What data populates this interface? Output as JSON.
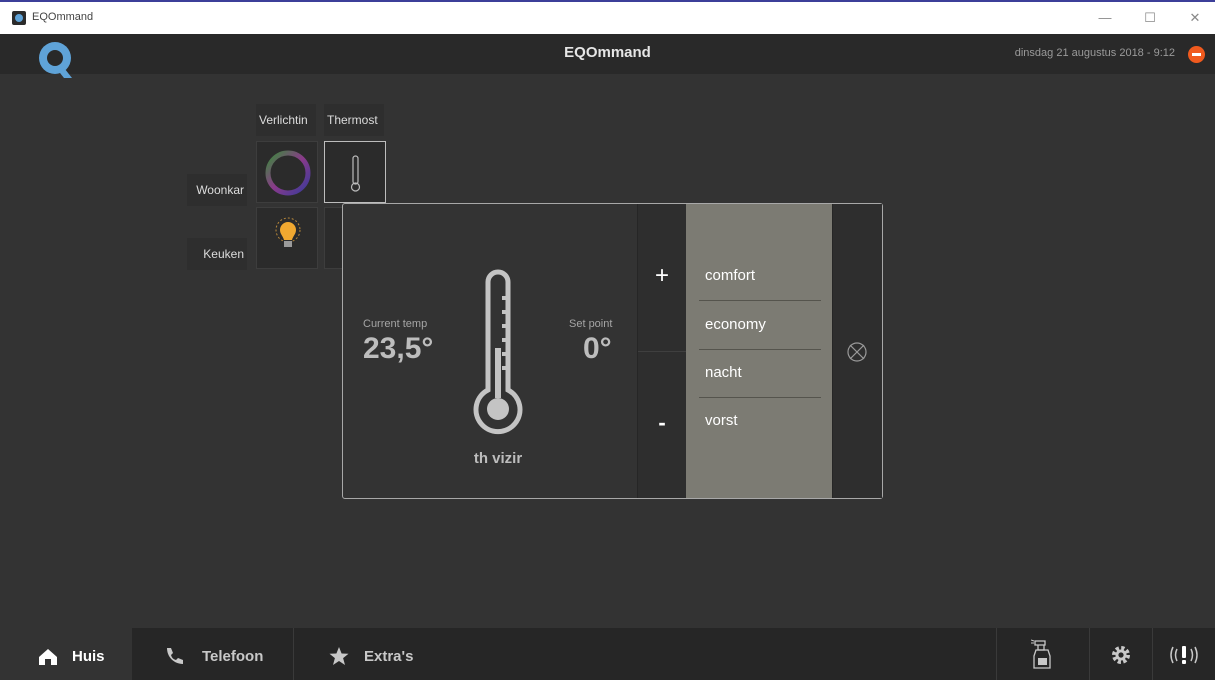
{
  "window": {
    "title": "EQOmmand",
    "controls": [
      "—",
      "☐",
      "✕"
    ]
  },
  "header": {
    "app_title": "EQOmmand",
    "datetime": "dinsdag 21 augustus 2018 - 9:12"
  },
  "grid": {
    "columns": [
      "Verlichtin",
      "Thermost"
    ],
    "rows": [
      "Woonkar",
      "Keuken"
    ]
  },
  "popup": {
    "current_temp_label": "Current temp",
    "current_temp_value": "23,5°",
    "set_point_label": "Set point",
    "set_point_value": "0°",
    "device_name": "th vizir",
    "plus_label": "+",
    "minus_label": "-",
    "modes": [
      "comfort",
      "economy",
      "nacht",
      "vorst"
    ]
  },
  "nav": {
    "tabs": [
      {
        "label": "Huis",
        "icon": "home-icon",
        "active": true
      },
      {
        "label": "Telefoon",
        "icon": "phone-icon",
        "active": false
      },
      {
        "label": "Extra's",
        "icon": "star-icon",
        "active": false
      }
    ],
    "right_icons": [
      "cleaning-spray-icon",
      "gear-icon",
      "alarm-icon"
    ]
  },
  "colors": {
    "background": "#333333",
    "mode_panel": "#7c7b73",
    "accent_stop": "#f05a1e",
    "logo": "#5fa3d8"
  }
}
